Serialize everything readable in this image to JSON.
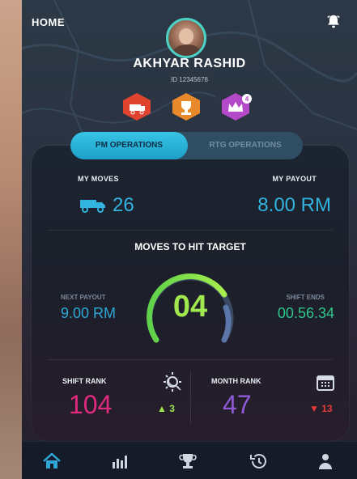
{
  "header": {
    "home_label": "HOME",
    "user_name": "AKHYAR RASHID",
    "user_sub": "ID 12345678"
  },
  "badges": [
    {
      "icon": "truck-badge-icon",
      "color": "#e0442f"
    },
    {
      "icon": "trophy-badge-icon",
      "color": "#e88a2b"
    },
    {
      "icon": "crown-badge-icon",
      "color": "#b449c9",
      "count": "4"
    }
  ],
  "tabs": [
    {
      "label": "PM OPERATIONS",
      "active": true
    },
    {
      "label": "RTG OPERATIONS",
      "active": false
    }
  ],
  "stats": {
    "my_moves_label": "MY MOVES",
    "my_moves_value": "26",
    "my_payout_label": "MY PAYOUT",
    "my_payout_value": "8.00 RM"
  },
  "target": {
    "title": "MOVES TO HIT TARGET",
    "value": "04",
    "next_payout_label": "NEXT PAYOUT",
    "next_payout_value": "9.00 RM",
    "shift_ends_label": "SHIFT ENDS",
    "shift_ends_value": "00.56.34"
  },
  "ranks": {
    "shift_rank_label": "SHIFT RANK",
    "shift_rank_value": "104",
    "shift_rank_delta": "▲ 3",
    "month_rank_label": "MONTH RANK",
    "month_rank_value": "47",
    "month_rank_delta": "▼ 13"
  },
  "nav": [
    {
      "icon": "home-icon",
      "active": true
    },
    {
      "icon": "bar-chart-icon",
      "active": false
    },
    {
      "icon": "trophy-icon",
      "active": false
    },
    {
      "icon": "history-icon",
      "active": false
    },
    {
      "icon": "profile-icon",
      "active": false
    }
  ],
  "colors": {
    "accent_cyan": "#32b4e0",
    "gauge_green": "#9fe84d",
    "shift_rank_pink": "#e02a7f",
    "month_rank_purple": "#8f5ad9",
    "up_green": "#9ee64c",
    "down_red": "#e63b3b"
  }
}
